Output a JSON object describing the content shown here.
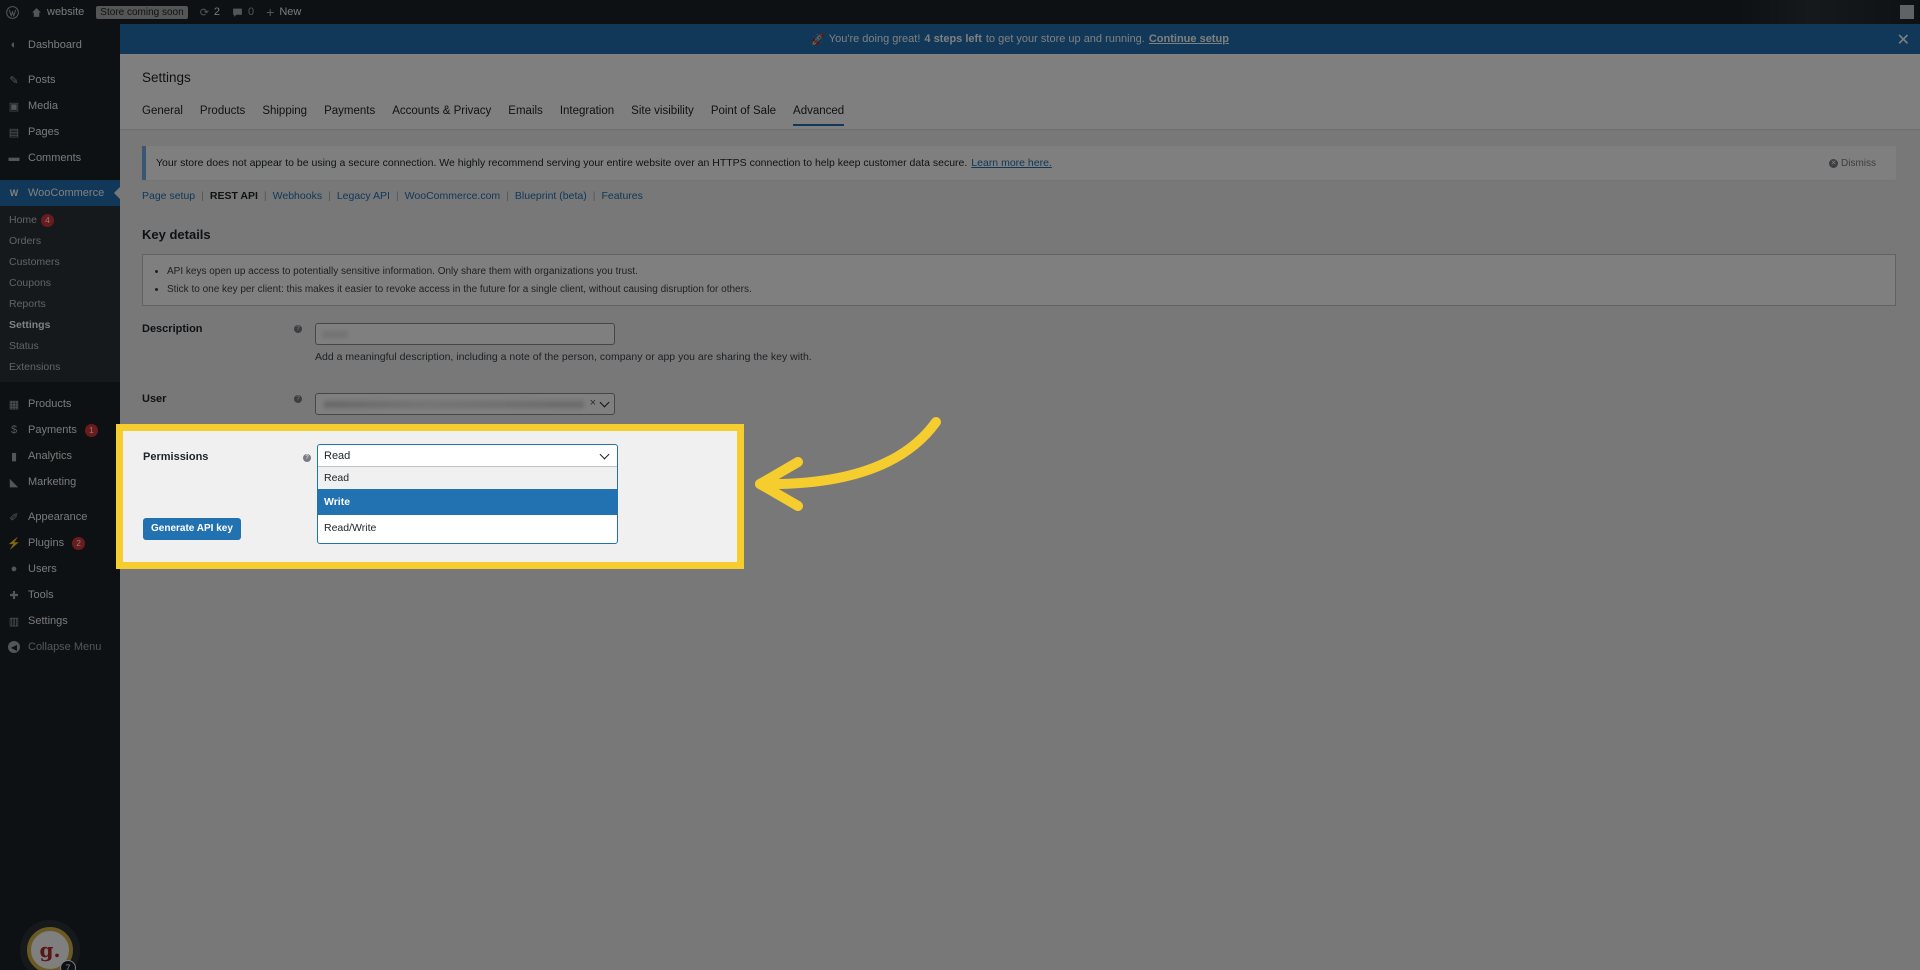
{
  "adminbar": {
    "site_name": "website",
    "store_badge": "Store coming soon",
    "updates": "2",
    "comments": "0",
    "new_label": "New"
  },
  "sidebar": {
    "dashboard": "Dashboard",
    "posts": "Posts",
    "media": "Media",
    "pages": "Pages",
    "comments": "Comments",
    "woocommerce": "WooCommerce",
    "sub": {
      "home": "Home",
      "home_count": "4",
      "orders": "Orders",
      "customers": "Customers",
      "coupons": "Coupons",
      "reports": "Reports",
      "settings": "Settings",
      "status": "Status",
      "extensions": "Extensions"
    },
    "products": "Products",
    "payments": "Payments",
    "payments_count": "1",
    "analytics": "Analytics",
    "marketing": "Marketing",
    "appearance": "Appearance",
    "plugins": "Plugins",
    "plugins_count": "2",
    "users": "Users",
    "tools": "Tools",
    "settings": "Settings",
    "collapse": "Collapse Menu",
    "chat_badge": "7"
  },
  "banner": {
    "emoji": "🚀",
    "text_before": "You're doing great!",
    "bold": "4 steps left",
    "text_after": "to get your store up and running.",
    "link": "Continue setup"
  },
  "page": {
    "title": "Settings",
    "tabs": [
      "General",
      "Products",
      "Shipping",
      "Payments",
      "Accounts & Privacy",
      "Emails",
      "Integration",
      "Site visibility",
      "Point of Sale",
      "Advanced"
    ]
  },
  "notice": {
    "text": "Your store does not appear to be using a secure connection. We highly recommend serving your entire website over an HTTPS connection to help keep customer data secure.",
    "link": "Learn more here.",
    "dismiss": "Dismiss"
  },
  "subnav": {
    "page_setup": "Page setup",
    "rest_api": "REST API",
    "webhooks": "Webhooks",
    "legacy_api": "Legacy API",
    "woocommerce_com": "WooCommerce.com",
    "blueprint": "Blueprint (beta)",
    "features": "Features"
  },
  "key_details": {
    "heading": "Key details",
    "bullets": [
      "API keys open up access to potentially sensitive information. Only share them with organizations you trust.",
      "Stick to one key per client: this makes it easier to revoke access in the future for a single client, without causing disruption for others."
    ]
  },
  "form": {
    "description_label": "Description",
    "description_help": "Add a meaningful description, including a note of the person, company or app you are sharing the key with.",
    "user_label": "User",
    "permissions_label": "Permissions",
    "permissions_value": "Read",
    "permissions_options": [
      "Read",
      "Write",
      "Read/Write"
    ],
    "generate_button": "Generate API key"
  },
  "colors": {
    "accent": "#2271b1",
    "highlight": "#f5cd2f",
    "admin_dark": "#1d2327"
  }
}
